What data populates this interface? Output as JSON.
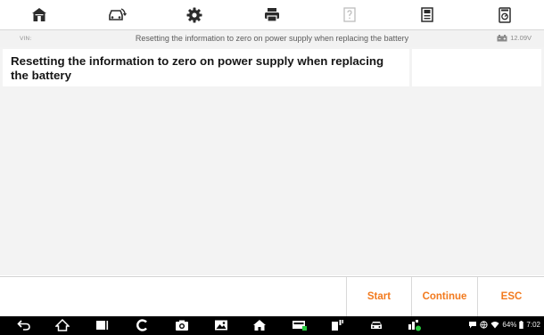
{
  "toolbar": {
    "buttons": [
      {
        "name": "home-icon"
      },
      {
        "name": "vehicle-swap-icon"
      },
      {
        "name": "settings-gear-icon"
      },
      {
        "name": "print-icon"
      },
      {
        "name": "help-icon"
      },
      {
        "name": "save-icon"
      },
      {
        "name": "data-logging-icon"
      }
    ]
  },
  "info_bar": {
    "vin_label": "VIN:",
    "title": "Resetting the information to zero on power supply when replacing the battery",
    "battery_voltage": "12.09V"
  },
  "main": {
    "heading": "Resetting the information to zero on power supply when replacing the battery"
  },
  "footer": {
    "start_label": "Start",
    "continue_label": "Continue",
    "esc_label": "ESC",
    "accent_color": "#f27a1e"
  },
  "navbar": {
    "battery_percent": "64%",
    "time": "7:02"
  }
}
